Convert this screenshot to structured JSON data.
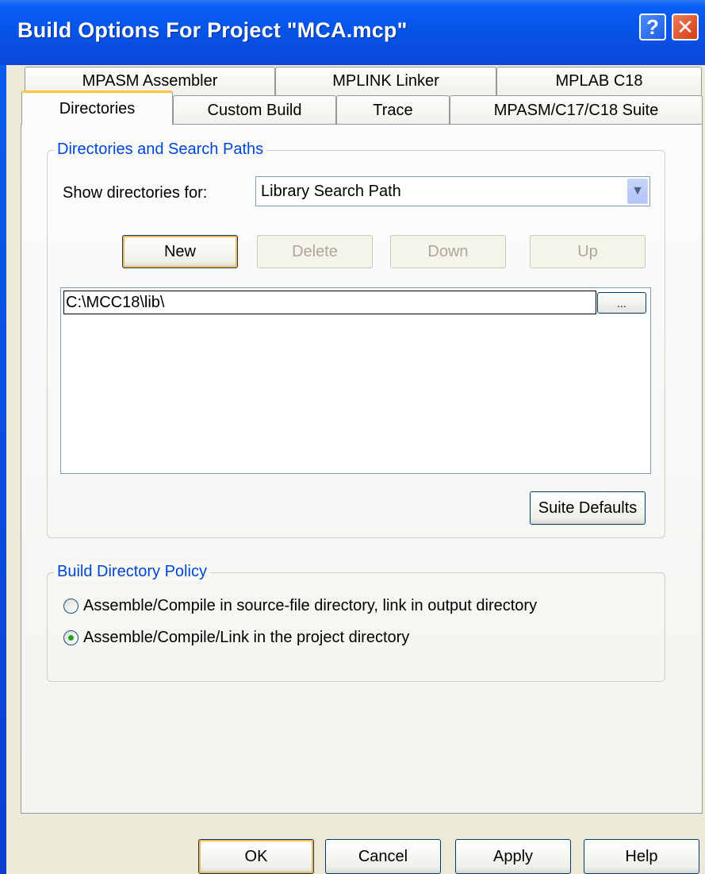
{
  "window": {
    "title": "Build Options For Project \"MCA.mcp\"",
    "help_label": "?",
    "close_label": "✕"
  },
  "tabs": {
    "row1": [
      "MPASM Assembler",
      "MPLINK Linker",
      "MPLAB C18"
    ],
    "row2": [
      "Directories",
      "Custom Build",
      "Trace",
      "MPASM/C17/C18 Suite"
    ],
    "active": "Directories"
  },
  "directories_group": {
    "legend": "Directories and Search Paths",
    "show_label": "Show directories for:",
    "show_value": "Library Search Path",
    "buttons": {
      "new": "New",
      "delete": "Delete",
      "down": "Down",
      "up": "Up"
    },
    "paths": [
      "C:\\MCC18\\lib\\"
    ],
    "browse_label": "...",
    "suite_defaults": "Suite Defaults"
  },
  "policy_group": {
    "legend": "Build Directory Policy",
    "options": [
      {
        "label": "Assemble/Compile in source-file directory, link in output directory",
        "checked": false
      },
      {
        "label": "Assemble/Compile/Link in the project directory",
        "checked": true
      }
    ]
  },
  "footer": {
    "ok": "OK",
    "cancel": "Cancel",
    "apply": "Apply",
    "help": "Help"
  }
}
